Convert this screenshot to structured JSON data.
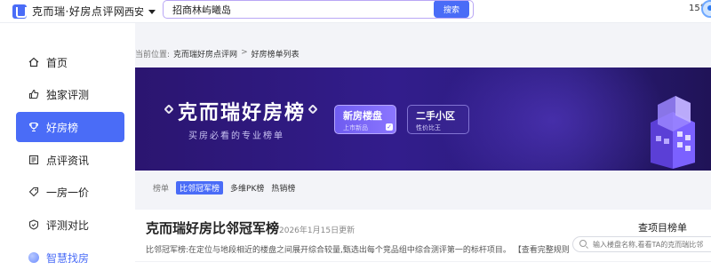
{
  "header": {
    "brand": "克而瑞·好房点评网",
    "city": "西安",
    "search_value": "招商林屿曦岛",
    "search_button": "搜索",
    "weather": "15°"
  },
  "sidebar": {
    "items": [
      {
        "label": "首页",
        "icon": "home-icon"
      },
      {
        "label": "独家评测",
        "icon": "thumbs-up-icon"
      },
      {
        "label": "好房榜",
        "icon": "trophy-icon",
        "active": true
      },
      {
        "label": "点评资讯",
        "icon": "news-icon"
      },
      {
        "label": "一房一价",
        "icon": "price-icon"
      },
      {
        "label": "评测对比",
        "icon": "compare-icon"
      },
      {
        "label": "智慧找房",
        "icon": "smart-search-icon"
      }
    ]
  },
  "breadcrumb": {
    "prefix": "当前位置:",
    "home": "克而瑞好房点评网",
    "separator": ">",
    "current": "好房榜单列表"
  },
  "banner": {
    "title": "克而瑞好房榜",
    "subtitle": "买房必看的专业榜单",
    "new_homes": {
      "title": "新房楼盘",
      "sub": "上市新品"
    },
    "second_hand": {
      "title": "二手小区",
      "sub": "性价比王"
    }
  },
  "tabs": {
    "label": "榜单",
    "items": [
      "比邻冠军榜",
      "多维PK榜",
      "热销榜"
    ],
    "active_index": 0
  },
  "ranking": {
    "title": "克而瑞好房比邻冠军榜",
    "date": "2026年1月15日更新",
    "description": "比邻冠军榜:在定位与地段相近的楼盘之间展开综合较量,甄选出每个竞品组中综合测评第一的标杆项目。",
    "rule_link": "【查看完整规则】",
    "find_title": "查项目榜单",
    "find_placeholder": "输入楼盘名称,看看TA的克而瑞比邻"
  },
  "colors": {
    "accent": "#4a6cf7",
    "banner_dark": "#2b1570",
    "banner_mid": "#321d8c"
  }
}
